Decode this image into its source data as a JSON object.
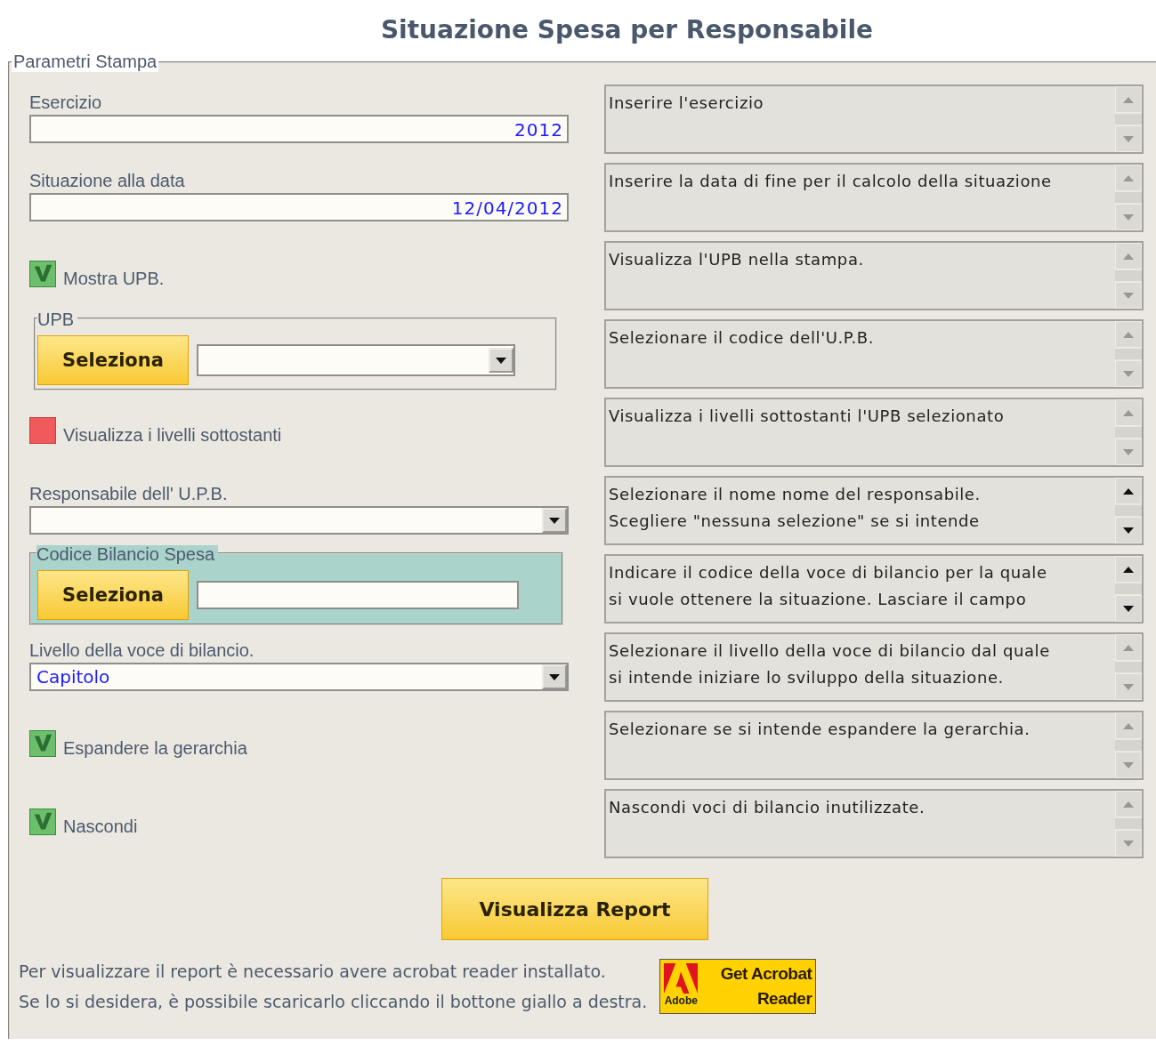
{
  "title": "Situazione Spesa per Responsabile",
  "panel": {
    "legend": "Parametri Stampa"
  },
  "rows": [
    {
      "kind": "text_field",
      "label": "Esercizio",
      "value": "2012",
      "help": [
        "Inserire l'esercizio"
      ],
      "help_scroll": false
    },
    {
      "kind": "text_field",
      "label": "Situazione alla data",
      "value": "12/04/2012",
      "help": [
        "Inserire la data di fine per il calcolo della situazione"
      ],
      "help_scroll": false
    },
    {
      "kind": "checkbox",
      "label": "Mostra UPB.",
      "checked": true,
      "help": [
        "Visualizza l'UPB nella stampa."
      ],
      "help_scroll": false
    },
    {
      "kind": "group",
      "legend": "UPB",
      "button": "Seleziona",
      "dropdown": true,
      "highlighted": false,
      "help": [
        "Selezionare il codice dell'U.P.B."
      ],
      "help_scroll": false
    },
    {
      "kind": "checkbox",
      "label": "Visualizza i livelli sottostanti",
      "checked": false,
      "help": [
        "Visualizza i livelli sottostanti l'UPB selezionato"
      ],
      "help_scroll": false
    },
    {
      "kind": "select",
      "label": "Responsabile dell' U.P.B.",
      "help": [
        "Selezionare il nome nome del responsabile.",
        "Scegliere \"nessuna selezione\" se si intende"
      ],
      "help_scroll": true
    },
    {
      "kind": "group",
      "legend": "Codice Bilancio Spesa",
      "button": "Seleziona",
      "dropdown": false,
      "highlighted": true,
      "help": [
        "Indicare il codice della voce di bilancio per la quale",
        "si vuole ottenere la  situazione. Lasciare il campo"
      ],
      "help_scroll": true
    },
    {
      "kind": "select",
      "label": "Livello della voce di bilancio.",
      "value": "Capitolo",
      "help": [
        "Selezionare il livello della voce di bilancio dal quale",
        "si intende iniziare lo sviluppo della situazione."
      ],
      "help_scroll": false
    },
    {
      "kind": "checkbox",
      "label": "Espandere la gerarchia",
      "checked": true,
      "help": [
        "Selezionare se si intende espandere la gerarchia."
      ],
      "help_scroll": false
    },
    {
      "kind": "checkbox",
      "label": "Nascondi",
      "checked": true,
      "help": [
        "Nascondi voci di bilancio inutilizzate."
      ],
      "help_scroll": false
    }
  ],
  "report_button": "Visualizza Report",
  "notes": [
    "Per visualizzare il report è necessario avere acrobat reader installato.",
    "Se lo si desidera, è possibile scaricarlo cliccando il bottone giallo a destra."
  ],
  "acrobat_badge": {
    "brand": "Adobe",
    "line_1": "Get Acrobat",
    "line_2": "Reader"
  }
}
